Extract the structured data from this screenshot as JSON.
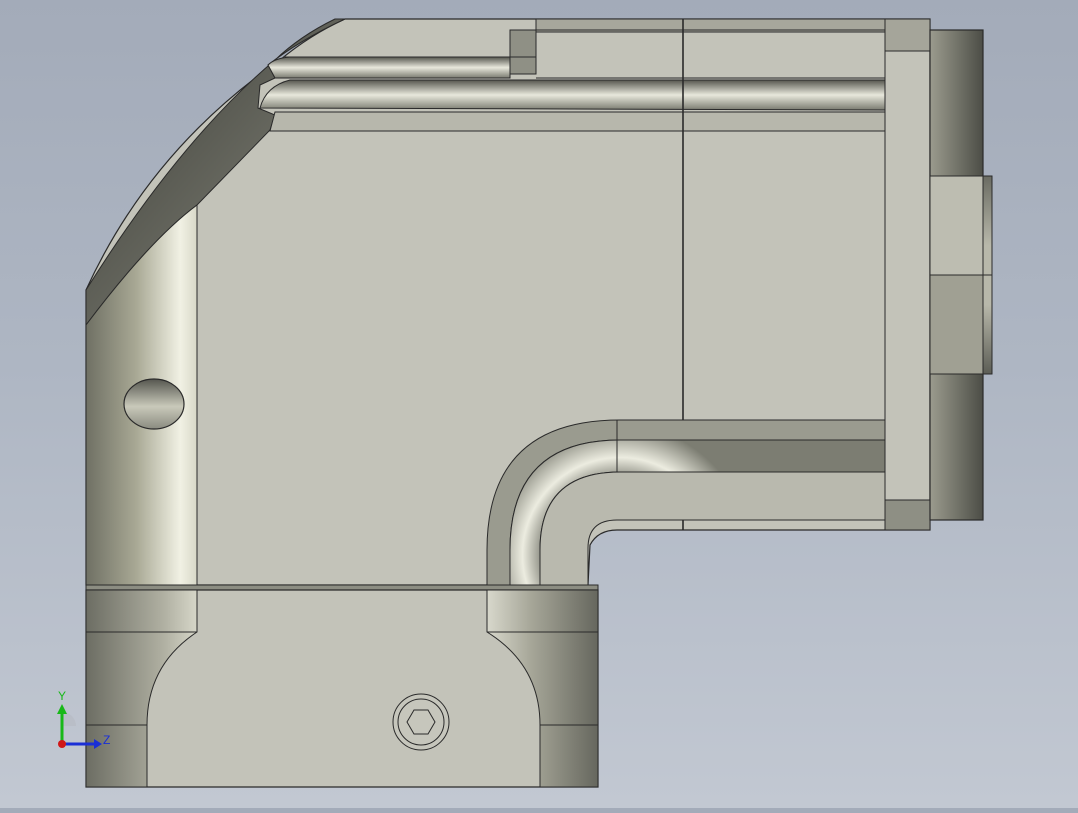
{
  "viewport": {
    "background_top": "#a3abb9",
    "background_bottom": "#c2c8d2",
    "part_face_color": "#c3c3b9",
    "edge_color": "#2a2a2a",
    "shadow_color": "#5e6058"
  },
  "triad": {
    "y_label": "Y",
    "z_label": "Z",
    "y_color": "#18b818",
    "z_color": "#1a2fd6",
    "x_color": "#d01818"
  },
  "parts": [
    {
      "name": "elbow-body",
      "icon": "elbow-body"
    },
    {
      "name": "bottom-clamp-block",
      "icon": "clamp-block"
    },
    {
      "name": "right-flange-hub",
      "icon": "flange"
    },
    {
      "name": "hex-socket-screw",
      "icon": "hex-socket-icon"
    },
    {
      "name": "side-hole",
      "icon": "hole"
    }
  ]
}
